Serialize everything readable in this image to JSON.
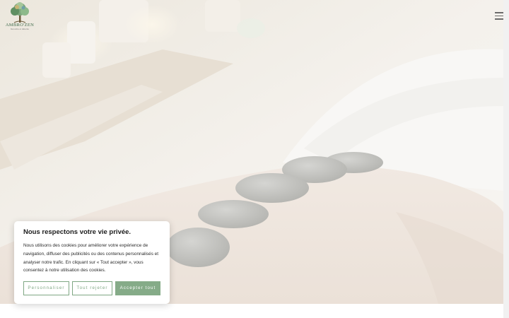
{
  "brand": {
    "name": "AMBRO'ZEN",
    "tagline": "bien-être et détente",
    "logo_icon": "tree-icon"
  },
  "header": {
    "menu_icon": "hamburger-menu-icon"
  },
  "cookie_banner": {
    "title": "Nous respectons votre vie privée.",
    "text": "Nous utilisons des cookies pour améliorer votre expérience de navigation, diffuser des publicités ou des contenus personnalisés et analyser notre trafic. En cliquant sur « Tout accepter », vous consentez à notre utilisation des cookies.",
    "customize_label": "Personnaliser",
    "reject_label": "Tout rejeter",
    "accept_label": "Accepter tout"
  },
  "colors": {
    "accent": "#85ab88",
    "logo_green": "#3f6b4a"
  }
}
